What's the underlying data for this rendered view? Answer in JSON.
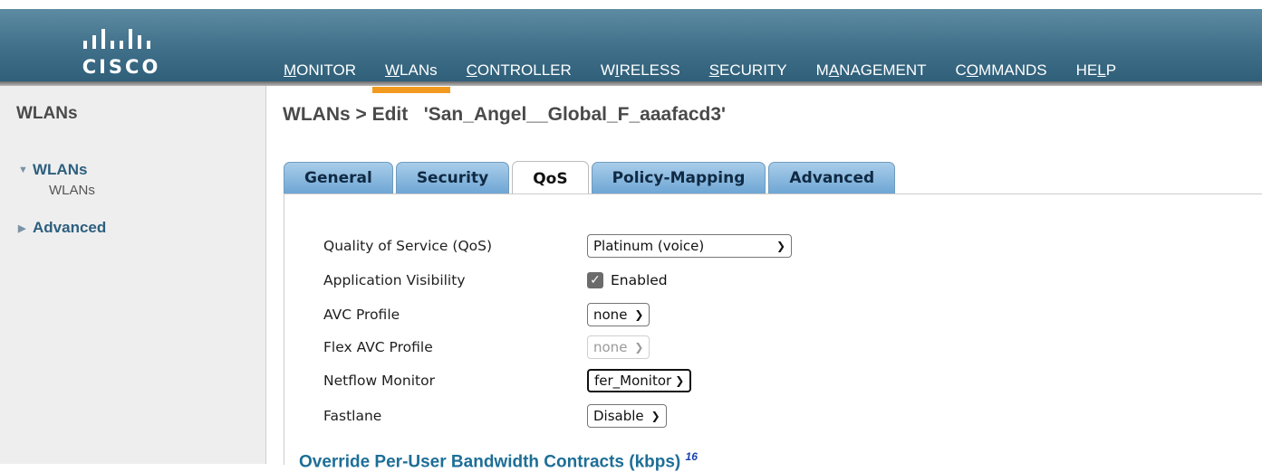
{
  "brand": {
    "logo_text": "CISCO"
  },
  "nav": [
    {
      "pre": "",
      "u": "M",
      "post": "ONITOR",
      "active": false
    },
    {
      "pre": "",
      "u": "W",
      "post": "LANs",
      "active": true
    },
    {
      "pre": "",
      "u": "C",
      "post": "ONTROLLER",
      "active": false
    },
    {
      "pre": "W",
      "u": "I",
      "post": "RELESS",
      "active": false
    },
    {
      "pre": "",
      "u": "S",
      "post": "ECURITY",
      "active": false
    },
    {
      "pre": "M",
      "u": "A",
      "post": "NAGEMENT",
      "active": false
    },
    {
      "pre": "C",
      "u": "O",
      "post": "MMANDS",
      "active": false
    },
    {
      "pre": "HE",
      "u": "L",
      "post": "P",
      "active": false
    }
  ],
  "sidebar": {
    "title": "WLANs",
    "groups": [
      {
        "label": "WLANs",
        "expanded": true,
        "sub": "WLANs"
      },
      {
        "label": "Advanced",
        "expanded": false
      }
    ]
  },
  "page": {
    "title": "WLANs > Edit   'San_Angel__Global_F_aaafacd3'"
  },
  "tabs": [
    {
      "label": "General",
      "active": false
    },
    {
      "label": "Security",
      "active": false
    },
    {
      "label": "QoS",
      "active": true
    },
    {
      "label": "Policy-Mapping",
      "active": false
    },
    {
      "label": "Advanced",
      "active": false
    }
  ],
  "form": {
    "qos": {
      "label": "Quality of Service (QoS)",
      "value": "Platinum (voice)"
    },
    "app_visibility": {
      "label": "Application Visibility",
      "checked": true,
      "checkbox_label": "Enabled"
    },
    "avc_profile": {
      "label": "AVC Profile",
      "value": "none"
    },
    "flex_avc_profile": {
      "label": "Flex AVC Profile",
      "value": "none",
      "disabled": true
    },
    "netflow_monitor": {
      "label": "Netflow Monitor",
      "value": "fer_Monitor"
    },
    "fastlane": {
      "label": "Fastlane",
      "value": "Disable"
    }
  },
  "section": {
    "title": "Override Per-User Bandwidth Contracts (kbps)",
    "footnote": "16"
  },
  "colors": {
    "accent": "#f29a1f",
    "banner": "#3f6f89",
    "tab": "#6ea6d4",
    "link": "#1d6e97"
  }
}
